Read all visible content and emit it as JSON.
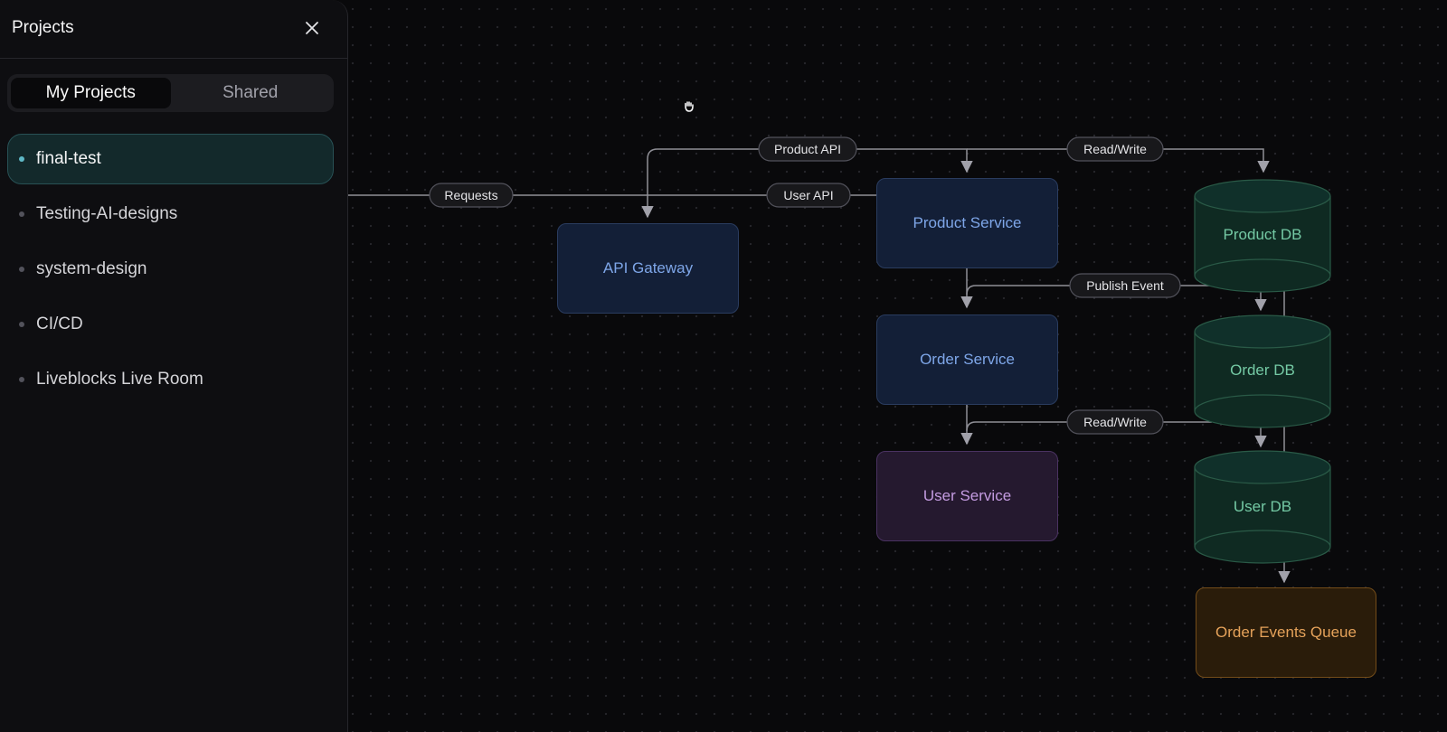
{
  "sidebar": {
    "title": "Projects",
    "tabs": [
      {
        "label": "My Projects",
        "active": true
      },
      {
        "label": "Shared",
        "active": false
      }
    ],
    "projects": [
      {
        "label": "final-test",
        "active": true
      },
      {
        "label": "Testing-AI-designs",
        "active": false
      },
      {
        "label": "system-design",
        "active": false
      },
      {
        "label": "CI/CD",
        "active": false
      },
      {
        "label": "Liveblocks Live Room",
        "active": false
      }
    ]
  },
  "diagram": {
    "nodes": {
      "api_gateway": "API Gateway",
      "product_service": "Product Service",
      "order_service": "Order Service",
      "user_service": "User Service",
      "product_db": "Product DB",
      "order_db": "Order DB",
      "user_db": "User DB",
      "order_events_queue": "Order Events Queue"
    },
    "edge_labels": {
      "requests": "Requests",
      "product_api": "Product API",
      "user_api": "User API",
      "read_write_top": "Read/Write",
      "publish_event": "Publish Event",
      "read_write_bottom": "Read/Write"
    }
  },
  "colors": {
    "canvas_bg": "#09090b",
    "service_node": "#131f37",
    "user_service_node": "#25192f",
    "database_node": "#0f2a22",
    "queue_node": "#2a1c0a",
    "active_project": "#13292b"
  },
  "icons": [
    "close-icon",
    "grab-hand-icon"
  ]
}
